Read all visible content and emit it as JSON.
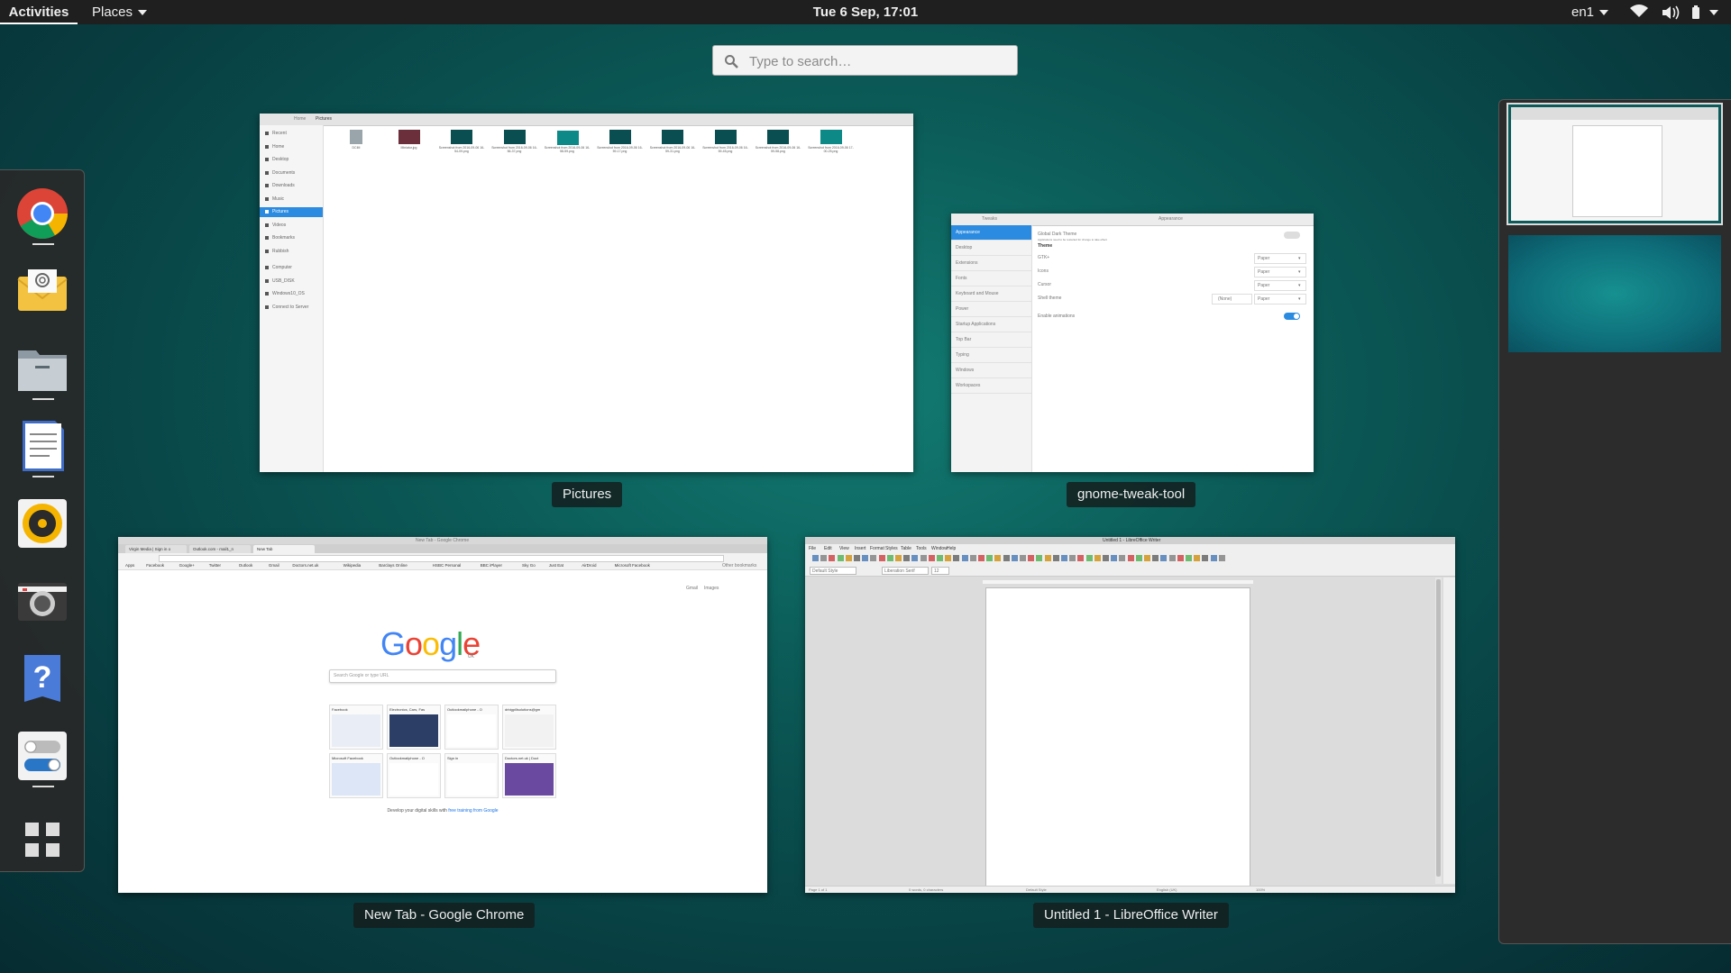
{
  "topbar": {
    "activities": "Activities",
    "places": "Places",
    "clock": "Tue  6 Sep, 17:01",
    "lang": "en1"
  },
  "search": {
    "placeholder": "Type to search…"
  },
  "dash": {
    "apps": [
      "chrome-icon",
      "mail-icon",
      "files-icon",
      "writer-icon",
      "rhythmbox-icon",
      "camera-icon",
      "help-icon",
      "tweaks-icon",
      "show-apps-icon"
    ]
  },
  "windows": {
    "files": {
      "caption": "Pictures",
      "path_home": "Home",
      "path_current": "Pictures",
      "sidebar": [
        "Recent",
        "Home",
        "Desktop",
        "Documents",
        "Downloads",
        "Music",
        "Pictures",
        "Videos",
        "Bookmarks",
        "Rubbish",
        "Computer",
        "USB_DISK",
        "Windows10_OS",
        "Connect to Server"
      ],
      "selected_index": 6,
      "files": [
        "DCIM",
        "Miniatur.jpg",
        "Screenshot from 2016-09-06 16-54-09.png",
        "Screenshot from 2016-09-06 16-56-37.png",
        "Screenshot from 2016-09-06 16-58-59.png",
        "Screenshot from 2016-09-06 16-59-17.png",
        "Screenshot from 2016-09-06 16-59-31.png",
        "Screenshot from 2016-09-06 16-59-45.png",
        "Screenshot from 2016-09-06 16-59-58.png",
        "Screenshot from 2016-09-06 17-00-25.png"
      ]
    },
    "tweak": {
      "caption": "gnome-tweak-tool",
      "title_left": "Tweaks",
      "title_right": "Appearance",
      "sidebar": [
        "Appearance",
        "Desktop",
        "Extensions",
        "Fonts",
        "Keyboard and Mouse",
        "Power",
        "Startup Applications",
        "Top Bar",
        "Typing",
        "Windows",
        "Workspaces"
      ],
      "global_dark": "Global Dark Theme",
      "global_dark_sub": "Applications need to be restarted for change to take effect",
      "theme_heading": "Theme",
      "rows": [
        {
          "label": "GTK+",
          "value": "Paper"
        },
        {
          "label": "Icons",
          "value": "Paper"
        },
        {
          "label": "Cursor",
          "value": "Paper"
        },
        {
          "label": "Shell theme",
          "value": "Paper",
          "extra": "(None)"
        }
      ],
      "animations": "Enable animations"
    },
    "chrome": {
      "caption": "New Tab - Google Chrome",
      "title": "New Tab - Google Chrome",
      "tabs": [
        "Virgin Media | Sign in o",
        "Outlook.com - mail1_n",
        "New Tab"
      ],
      "bookmarks": [
        "Apps",
        "Facebook",
        "Google+",
        "Twitter",
        "Outlook",
        "Gmail",
        "Doctors.net.uk",
        "Wikipedia",
        "Barclays Online",
        "HSBC Personal",
        "BBC iPlayer",
        "Sky Go",
        "Just Eat",
        "AirDroid",
        "Microsoft Facebook"
      ],
      "other_bookmarks": "Other bookmarks",
      "top_links": [
        "Gmail",
        "Images"
      ],
      "logo_letters": [
        "G",
        "o",
        "o",
        "g",
        "l",
        "e"
      ],
      "logo_sub": "UK",
      "search_placeholder": "Search Google or type URL",
      "tiles": [
        "Facebook",
        "Electronics, Cars, Fas",
        "Outlookmailphone - O",
        "drbigpillsolutions@gm",
        "Microsoft Facebook",
        "Outlookmailphone - O",
        "Sign in",
        "Doctors.net.uk | Doct"
      ],
      "footer": "Develop your digital skills with",
      "footer_link": "free training from Google"
    },
    "writer": {
      "caption": "Untitled 1 - LibreOffice Writer",
      "title": "Untitled 1 - LibreOffice Writer",
      "menu": [
        "File",
        "Edit",
        "View",
        "Insert",
        "Format",
        "Styles",
        "Table",
        "Tools",
        "Window",
        "Help"
      ],
      "style": "Default Style",
      "font": "Liberation Serif",
      "size": "12",
      "status": [
        "Page 1 of 1",
        "0 words, 0 characters",
        "Default Style",
        "English (UK)",
        "100%"
      ]
    }
  },
  "colors": {
    "accent": "#2a8be0",
    "topbar": "#1f1f1f"
  }
}
